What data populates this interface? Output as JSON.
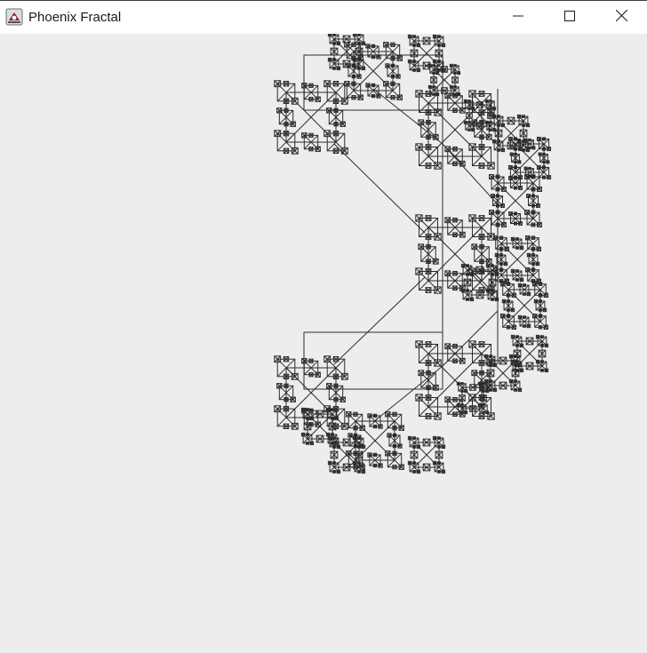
{
  "window": {
    "title": "Phoenix Fractal",
    "icons": {
      "app": "java-app-icon",
      "minimize": "minimize-icon",
      "maximize": "maximize-icon",
      "close": "close-icon"
    }
  },
  "canvas": {
    "background": "#ededed",
    "stroke": "#2b2b2b"
  }
}
